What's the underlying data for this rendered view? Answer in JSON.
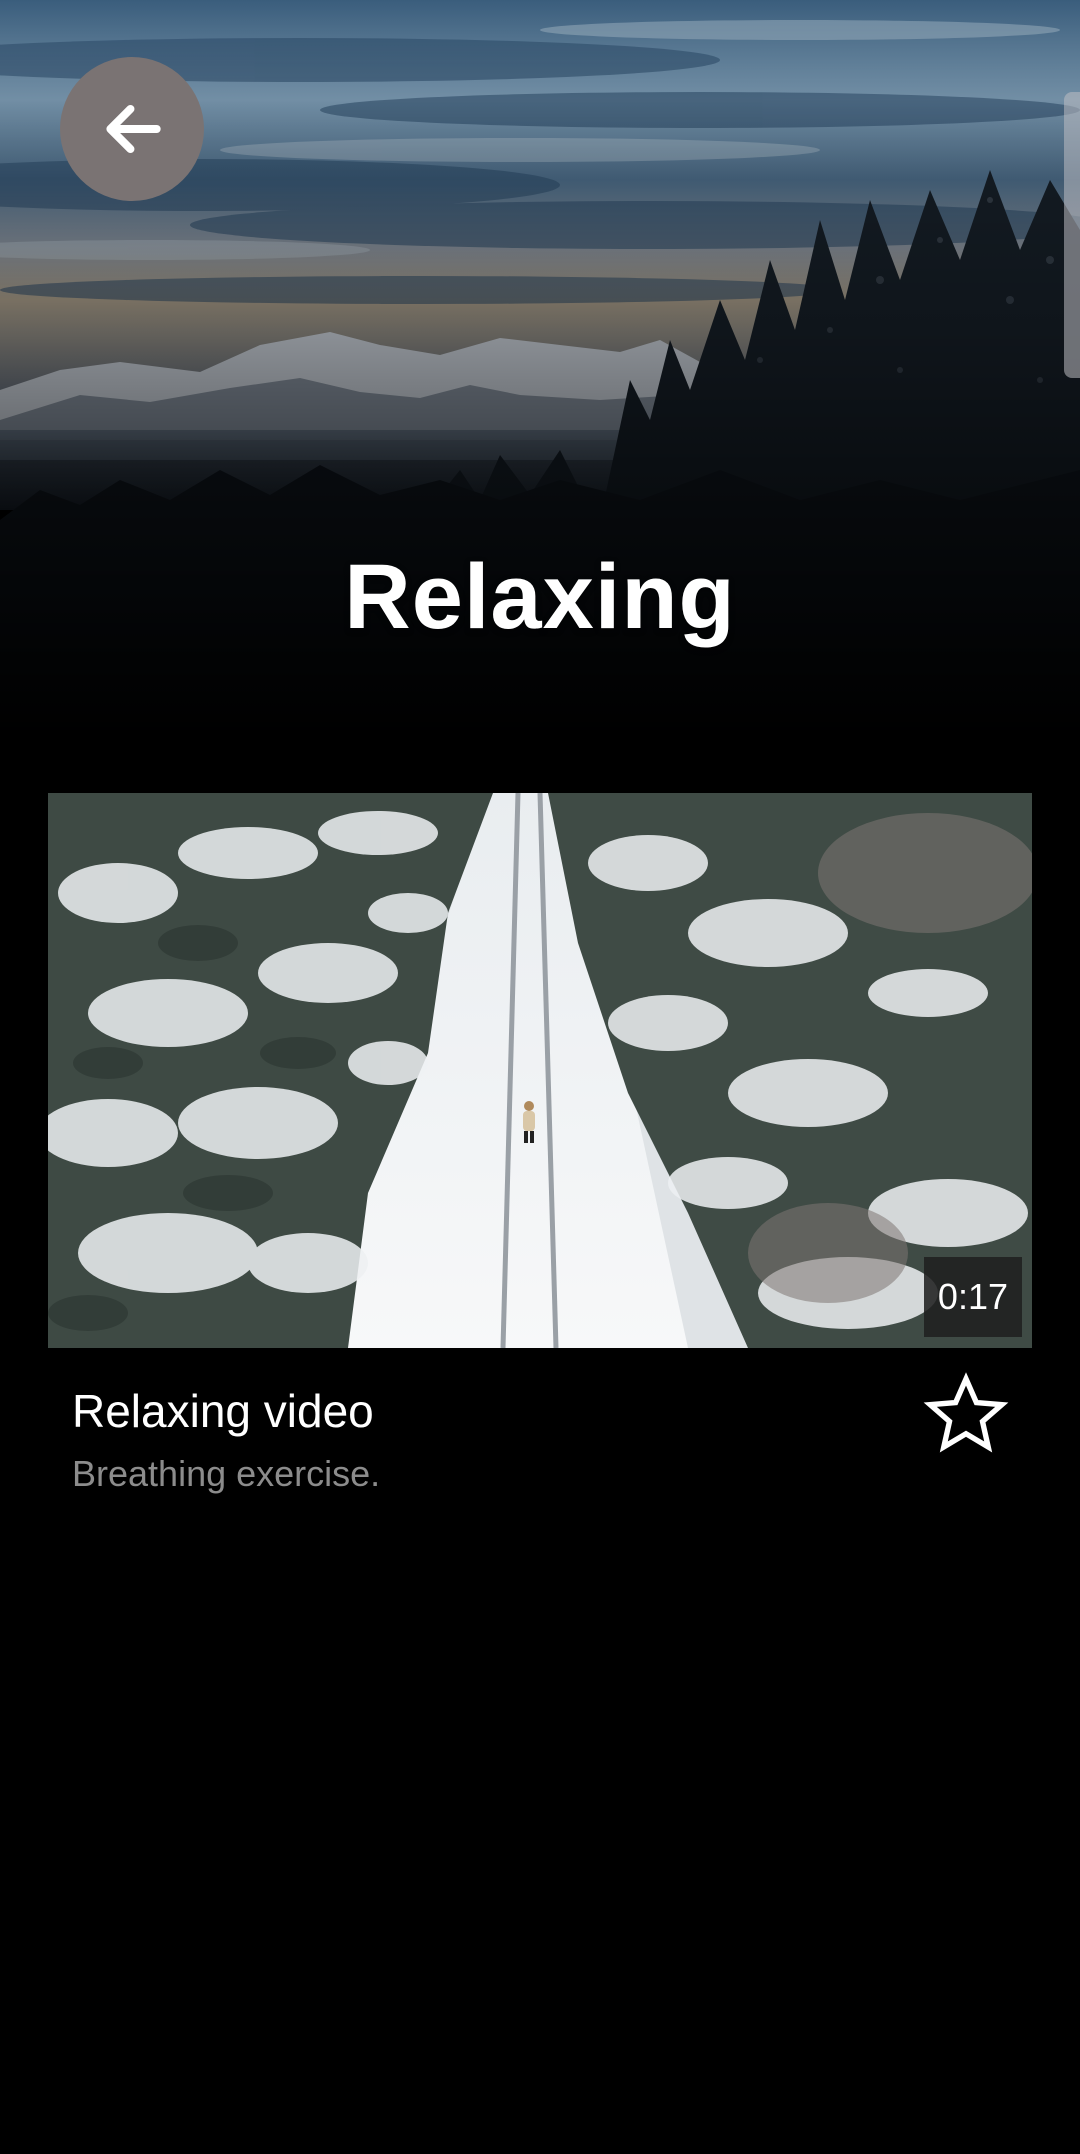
{
  "header": {
    "title": "Relaxing",
    "back_icon": "arrow-left-icon"
  },
  "videos": [
    {
      "title": "Relaxing video",
      "subtitle": "Breathing exercise.",
      "duration": "0:17",
      "favorite_icon": "star-outline-icon"
    }
  ],
  "colors": {
    "background": "#000000",
    "back_button": "#7a7373",
    "subtitle_text": "#8c8c8c",
    "badge_background": "#202020"
  }
}
